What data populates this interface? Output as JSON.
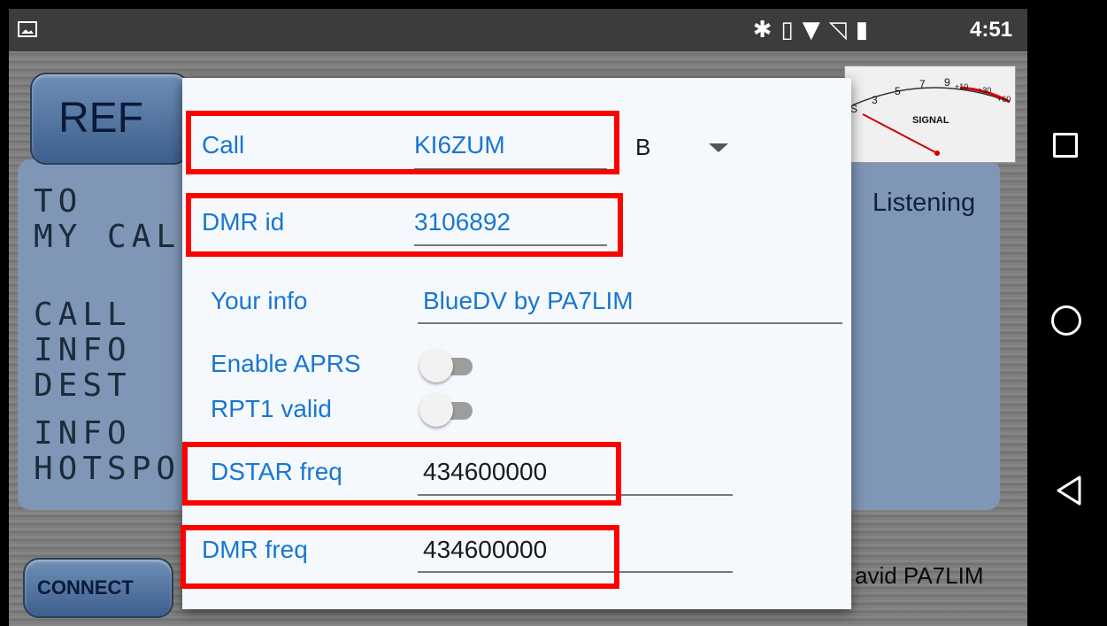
{
  "status_bar": {
    "time": "4:51",
    "icons": [
      "image-icon",
      "bluetooth-icon",
      "vibrate-icon",
      "wifi-icon",
      "no-sim-icon",
      "battery-icon"
    ]
  },
  "background_app": {
    "ref_button": "REF",
    "connect_button": "CONNECT",
    "lcd_left_lines": [
      "TO",
      "MY CAL",
      "",
      "CALL",
      "INFO",
      "DEST",
      "",
      "INFO",
      "HOTSPO"
    ],
    "status": "Listening",
    "signal_meter": {
      "label": "SIGNAL",
      "scale": [
        "S",
        "3",
        "5",
        "7",
        "9",
        "+10",
        "+30",
        "+60"
      ]
    },
    "author": "avid PA7LIM"
  },
  "dialog": {
    "call": {
      "label": "Call",
      "value": "KI6ZUM",
      "module": "B"
    },
    "dmr_id": {
      "label": "DMR id",
      "value": "3106892"
    },
    "your_info": {
      "label": "Your info",
      "value": "BlueDV by PA7LIM"
    },
    "enable_aprs": {
      "label": "Enable APRS",
      "on": false
    },
    "rpt1_valid": {
      "label": "RPT1 valid",
      "on": false
    },
    "dstar_freq": {
      "label": "DSTAR freq",
      "value": "434600000"
    },
    "dmr_freq": {
      "label": "DMR freq",
      "value": "434600000"
    }
  },
  "colors": {
    "accent": "#1976d2",
    "highlight": "#ff0000",
    "active_underline": "#1a9c8c"
  }
}
